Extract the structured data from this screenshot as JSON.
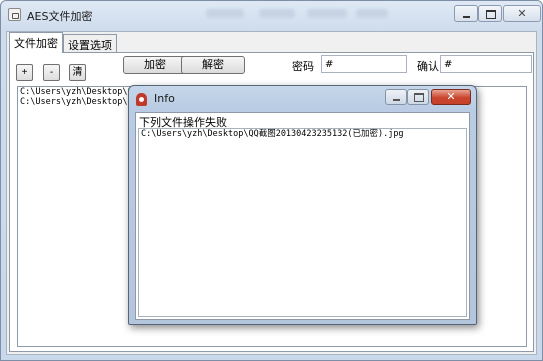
{
  "window": {
    "title": "AES文件加密"
  },
  "tabs": [
    {
      "label": "文件加密",
      "active": true
    },
    {
      "label": "设置选项",
      "active": false
    }
  ],
  "toolbar": {
    "add_label": "+",
    "remove_label": "-",
    "clear_label": "清",
    "encrypt_label": "加密",
    "decrypt_label": "解密",
    "password_label": "密码",
    "password_value": "#",
    "confirm_label": "确认",
    "confirm_value": "#"
  },
  "file_list": [
    "C:\\Users\\yzh\\Desktop\\QQ截图20130423235132(已加密).jpg",
    "C:\\Users\\yzh\\Desktop\\QQ截图20130423235132(已加密).jpg"
  ],
  "info_dialog": {
    "title": "Info",
    "message": "下列文件操作失败",
    "files": [
      "C:\\Users\\yzh\\Desktop\\QQ截图20130423235132(已加密).jpg"
    ]
  }
}
